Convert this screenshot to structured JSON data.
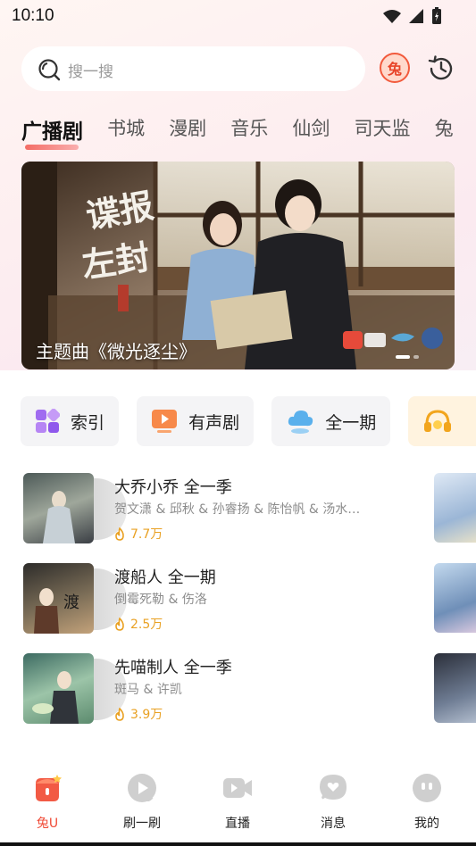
{
  "status_bar": {
    "time": "10:10"
  },
  "search": {
    "placeholder": "搜一搜"
  },
  "header": {
    "tu_badge": "兔"
  },
  "tabs": [
    "广播剧",
    "书城",
    "漫剧",
    "音乐",
    "仙剑",
    "司天监",
    "兔"
  ],
  "banner": {
    "caption": "主题曲《微光逐尘》",
    "title_art": "谍报左封",
    "dots": 2,
    "active_dot": 1
  },
  "quick_entries": [
    {
      "label": "索引",
      "icon": "grid-icon"
    },
    {
      "label": "有声剧",
      "icon": "play-screen-icon"
    },
    {
      "label": "全一期",
      "icon": "cloud-icon"
    },
    {
      "label": "",
      "icon": "headphone-icon"
    }
  ],
  "drama_list": [
    {
      "title": "大乔小乔 全一季",
      "cast": "贺文潇 & 邱秋 & 孙睿扬 & 陈怡帆 & 汤水…",
      "plays": "7.7万"
    },
    {
      "title": "渡船人 全一期",
      "cast": "倒霉死勒 & 伤洛",
      "plays": "2.5万"
    },
    {
      "title": "先喵制人 全一季",
      "cast": "斑马 & 许凯",
      "plays": "3.9万"
    }
  ],
  "bottom_nav": [
    {
      "label": "兔U",
      "icon": "tu-u-icon",
      "active": true
    },
    {
      "label": "刷一刷",
      "icon": "play-circle-icon",
      "active": false
    },
    {
      "label": "直播",
      "icon": "video-camera-icon",
      "active": false
    },
    {
      "label": "消息",
      "icon": "message-icon",
      "active": false
    },
    {
      "label": "我的",
      "icon": "profile-icon",
      "active": false
    }
  ],
  "colors": {
    "accent": "#f04a36",
    "plays": "#e9a123"
  }
}
